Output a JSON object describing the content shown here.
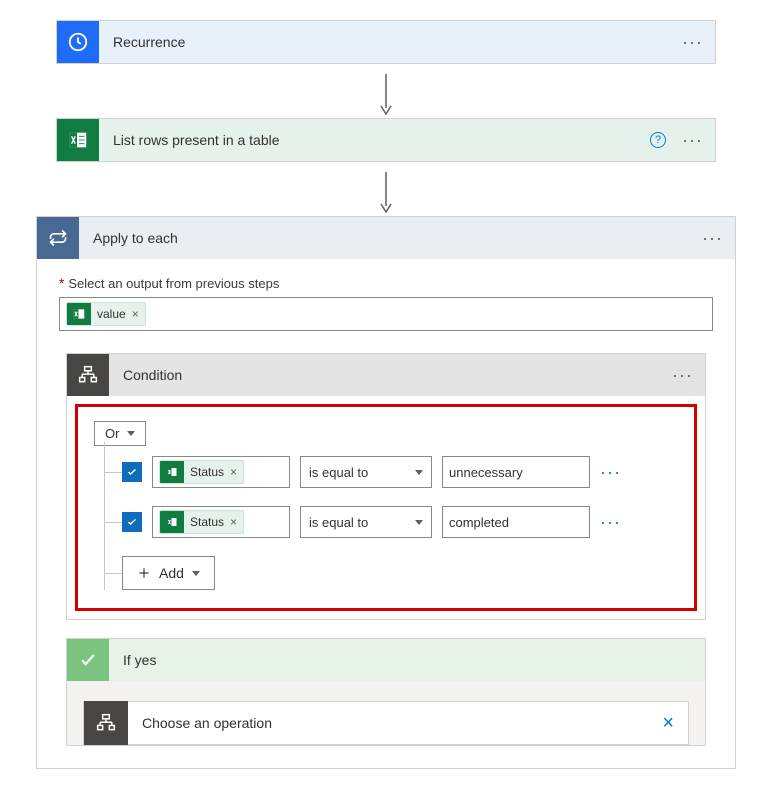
{
  "recurrence": {
    "title": "Recurrence"
  },
  "excel_step": {
    "title": "List rows present in a table"
  },
  "apply_each": {
    "title": "Apply to each",
    "select_label": "Select an output from previous steps",
    "token": "value"
  },
  "condition": {
    "title": "Condition",
    "logic": "Or",
    "rows": [
      {
        "field": "Status",
        "operator": "is equal to",
        "value": "unnecessary"
      },
      {
        "field": "Status",
        "operator": "is equal to",
        "value": "completed"
      }
    ],
    "add_label": "Add"
  },
  "if_yes": {
    "title": "If yes"
  },
  "choose_op": {
    "title": "Choose an operation"
  }
}
